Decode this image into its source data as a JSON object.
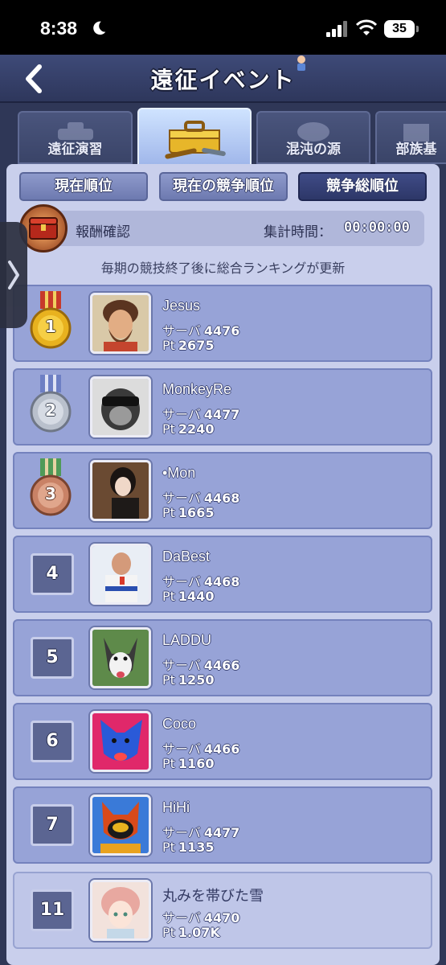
{
  "status": {
    "time": "8:38",
    "battery": "35"
  },
  "header": {
    "title": "遠征イベント"
  },
  "category_tabs": [
    {
      "label": "遠征演習",
      "active": false
    },
    {
      "label": "",
      "active": true
    },
    {
      "label": "混沌の源",
      "active": false
    },
    {
      "label": "部族基",
      "active": false
    }
  ],
  "subtabs": [
    {
      "label": "現在順位",
      "active": false
    },
    {
      "label": "現在の競争順位",
      "active": false
    },
    {
      "label": "競争総順位",
      "active": true
    }
  ],
  "reward": {
    "label": "報酬確認",
    "timer_label": "集計時間：",
    "timer_value": "00:00:00"
  },
  "notice": "毎期の競技終了後に総合ランキングが更新",
  "labels": {
    "server": "サーバ",
    "pt": "Pt"
  },
  "rankings": [
    {
      "rank": "1",
      "name": "Jesus",
      "server": "4476",
      "pt": "2675",
      "medal": "gold"
    },
    {
      "rank": "2",
      "name": "MonkeyRe",
      "server": "4477",
      "pt": "2240",
      "medal": "silver"
    },
    {
      "rank": "3",
      "name": "•Mon",
      "server": "4468",
      "pt": "1665",
      "medal": "bronze"
    },
    {
      "rank": "4",
      "name": "DaBest",
      "server": "4468",
      "pt": "1440"
    },
    {
      "rank": "5",
      "name": "LADDU",
      "server": "4466",
      "pt": "1250"
    },
    {
      "rank": "6",
      "name": "Coco",
      "server": "4466",
      "pt": "1160"
    },
    {
      "rank": "7",
      "name": "HiHi",
      "server": "4477",
      "pt": "1135"
    },
    {
      "rank": "11",
      "name": "丸みを帯びた雪",
      "server": "4470",
      "pt": "1.07K",
      "mine": true
    }
  ],
  "colors": {
    "gold": "#e8b21f",
    "silver": "#b9c0cc",
    "bronze": "#c98266",
    "panel": "#c9cfec",
    "row": "#97a3d7"
  }
}
